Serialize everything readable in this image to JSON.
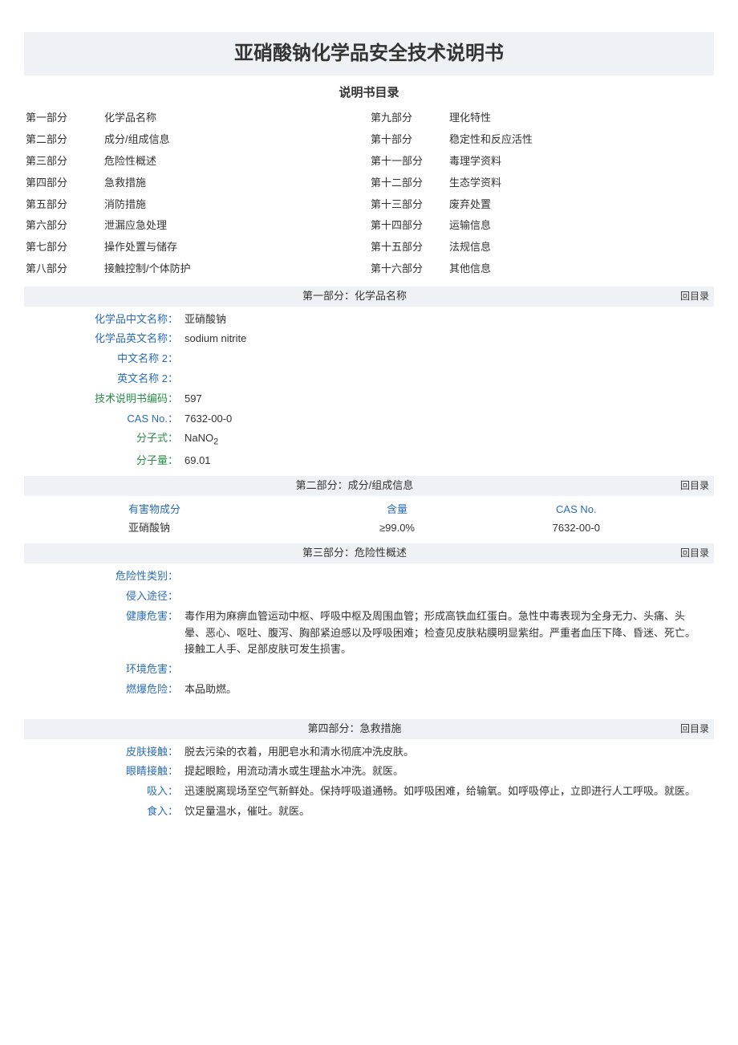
{
  "title": "亚硝酸钠化学品安全技术说明书",
  "subtitle": "说明书目录",
  "back_link": "回目录",
  "toc": {
    "left": [
      {
        "part": "第一部分",
        "name": "化学品名称"
      },
      {
        "part": "第二部分",
        "name": "成分/组成信息"
      },
      {
        "part": "第三部分",
        "name": "危险性概述"
      },
      {
        "part": "第四部分",
        "name": "急救措施"
      },
      {
        "part": "第五部分",
        "name": "消防措施"
      },
      {
        "part": "第六部分",
        "name": "泄漏应急处理"
      },
      {
        "part": "第七部分",
        "name": "操作处置与储存"
      },
      {
        "part": "第八部分",
        "name": "接触控制/个体防护"
      }
    ],
    "right": [
      {
        "part": "第九部分",
        "name": "理化特性"
      },
      {
        "part": "第十部分",
        "name": "稳定性和反应活性"
      },
      {
        "part": "第十一部分",
        "name": "毒理学资料"
      },
      {
        "part": "第十二部分",
        "name": "生态学资料"
      },
      {
        "part": "第十三部分",
        "name": "废弃处置"
      },
      {
        "part": "第十四部分",
        "name": "运输信息"
      },
      {
        "part": "第十五部分",
        "name": "法规信息"
      },
      {
        "part": "第十六部分",
        "name": "其他信息"
      }
    ]
  },
  "sections": {
    "s1": {
      "title": "第一部分：化学品名称"
    },
    "s2": {
      "title": "第二部分：成分/组成信息"
    },
    "s3": {
      "title": "第三部分：危险性概述"
    },
    "s4": {
      "title": "第四部分：急救措施"
    }
  },
  "identification": {
    "cn_name_label": "化学品中文名称：",
    "cn_name": "亚硝酸钠",
    "en_name_label": "化学品英文名称：",
    "en_name": "sodium nitrite",
    "cn_name2_label": "中文名称 2：",
    "cn_name2": "",
    "en_name2_label": "英文名称 2：",
    "en_name2": "",
    "code_label": "技术说明书编码：",
    "code": "597",
    "cas_label": "CAS No.：",
    "cas": "7632-00-0",
    "formula_label": "分子式：",
    "formula_base": "NaNO",
    "formula_sub": "2",
    "mw_label": "分子量：",
    "mw": "69.01"
  },
  "composition": {
    "headers": {
      "ingredient": "有害物成分",
      "content": "含量",
      "cas": "CAS No."
    },
    "rows": [
      {
        "ingredient": "亚硝酸钠",
        "content": "≥99.0%",
        "cas": "7632-00-0"
      }
    ]
  },
  "hazards": {
    "category_label": "危险性类别：",
    "category": "",
    "route_label": "侵入途径：",
    "route": "",
    "health_label": "健康危害：",
    "health": "毒作用为麻痹血管运动中枢、呼吸中枢及周围血管；形成高铁血红蛋白。急性中毒表现为全身无力、头痛、头晕、恶心、呕吐、腹泻、胸部紧迫感以及呼吸困难；检查见皮肤粘膜明显紫绀。严重者血压下降、昏迷、死亡。接触工人手、足部皮肤可发生损害。",
    "env_label": "环境危害：",
    "env": "",
    "fire_label": "燃爆危险：",
    "fire": "本品助燃。"
  },
  "firstaid": {
    "skin_label": "皮肤接触：",
    "skin": "脱去污染的衣着，用肥皂水和清水彻底冲洗皮肤。",
    "eye_label": "眼睛接触：",
    "eye": "提起眼睑，用流动清水或生理盐水冲洗。就医。",
    "inhale_label": "吸入：",
    "inhale": "迅速脱离现场至空气新鲜处。保持呼吸道通畅。如呼吸困难，给输氧。如呼吸停止，立即进行人工呼吸。就医。",
    "ingest_label": "食入：",
    "ingest": "饮足量温水，催吐。就医。"
  }
}
